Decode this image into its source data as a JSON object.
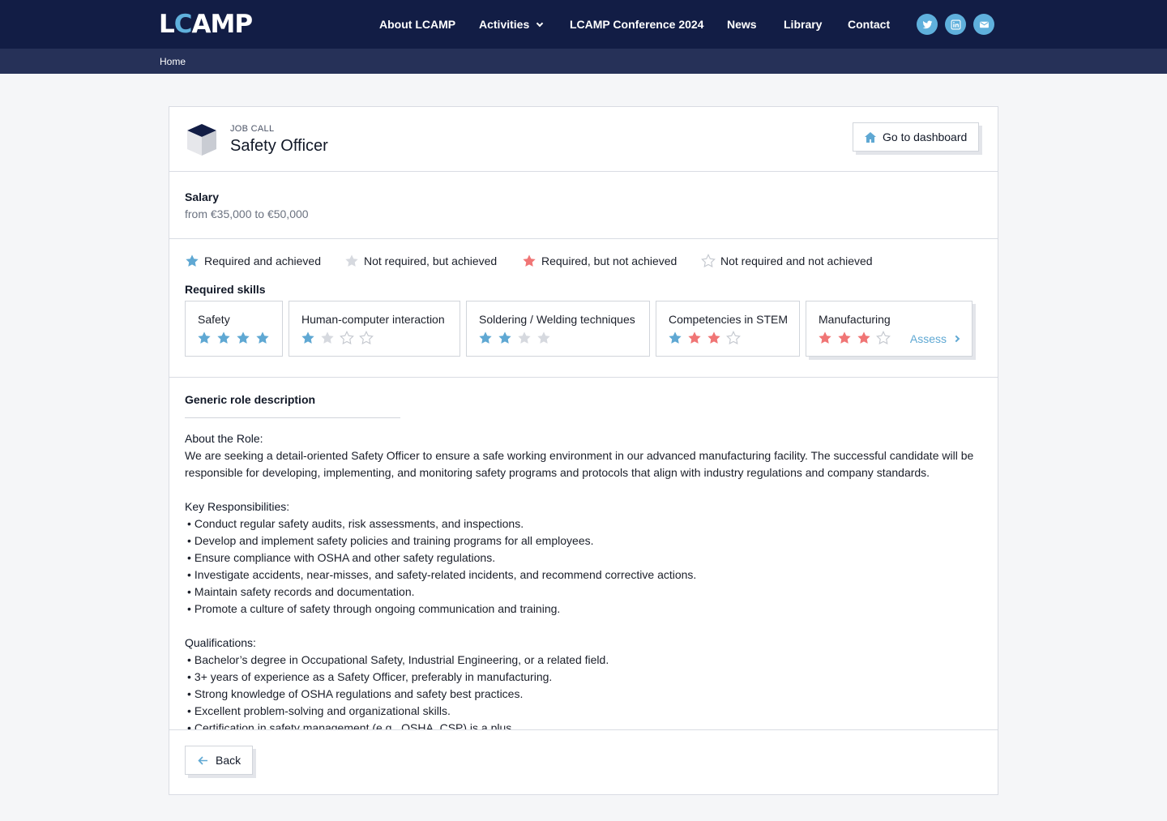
{
  "nav": {
    "logo": "LCAMP",
    "items": [
      {
        "label": "About LCAMP"
      },
      {
        "label": "Activities"
      },
      {
        "label": "LCAMP Conference 2024"
      },
      {
        "label": "News"
      },
      {
        "label": "Library"
      },
      {
        "label": "Contact"
      }
    ],
    "social_icons": [
      "twitter-icon",
      "linkedin-icon",
      "mail-icon"
    ]
  },
  "breadcrumb": "Home",
  "header": {
    "eyebrow": "JOB CALL",
    "title": "Safety Officer",
    "dashboard_label": "Go to dashboard"
  },
  "salary": {
    "label": "Salary",
    "value": "from €35,000 to €50,000"
  },
  "legend": [
    {
      "label": "Required and achieved",
      "color": "#5fa8d3"
    },
    {
      "label": "Not required, but achieved",
      "color": "#d6d9df"
    },
    {
      "label": "Required, but not achieved",
      "color": "#f07575"
    },
    {
      "label": "Not required and not achieved",
      "color": "outline"
    }
  ],
  "skills": {
    "label": "Required skills",
    "assess_label": "Assess",
    "items": [
      {
        "name": "Safety",
        "stars": [
          "blue",
          "blue",
          "blue",
          "blue"
        ]
      },
      {
        "name": "Human-computer interaction",
        "stars": [
          "blue",
          "grey",
          "outline",
          "outline"
        ]
      },
      {
        "name": "Soldering / Welding techniques",
        "stars": [
          "blue",
          "blue",
          "grey",
          "grey"
        ]
      },
      {
        "name": "Competencies in STEM",
        "stars": [
          "blue",
          "red",
          "red",
          "outline"
        ]
      },
      {
        "name": "Manufacturing",
        "stars": [
          "red",
          "red",
          "red",
          "outline"
        ]
      }
    ]
  },
  "description": {
    "title": "Generic role description",
    "about_heading": "About the Role:",
    "about_text": "We are seeking a detail-oriented Safety Officer to ensure a safe working environment in our advanced manufacturing facility. The successful candidate will be responsible for developing, implementing, and monitoring safety programs and protocols that align with industry regulations and company standards.",
    "responsibilities_heading": "Key Responsibilities:",
    "responsibilities": [
      "Conduct regular safety audits, risk assessments, and inspections.",
      "Develop and implement safety policies and training programs for all employees.",
      "Ensure compliance with OSHA and other safety regulations.",
      "Investigate accidents, near-misses, and safety-related incidents, and recommend corrective actions.",
      "Maintain safety records and documentation.",
      "Promote a culture of safety through ongoing communication and training."
    ],
    "qualifications_heading": "Qualifications:",
    "qualifications": [
      "Bachelor’s degree in Occupational Safety, Industrial Engineering, or a related field.",
      "3+ years of experience as a Safety Officer, preferably in manufacturing.",
      "Strong knowledge of OSHA regulations and safety best practices.",
      "Excellent problem-solving and organizational skills.",
      "Certification in safety management (e.g., OSHA, CSP) is a plus."
    ]
  },
  "footer": {
    "back_label": "Back"
  },
  "colors": {
    "nav_bg": "#121d45",
    "breadcrumb_bg": "#263158",
    "accent": "#5fa8d3",
    "star_red": "#f07575",
    "star_grey": "#d6d9df"
  }
}
